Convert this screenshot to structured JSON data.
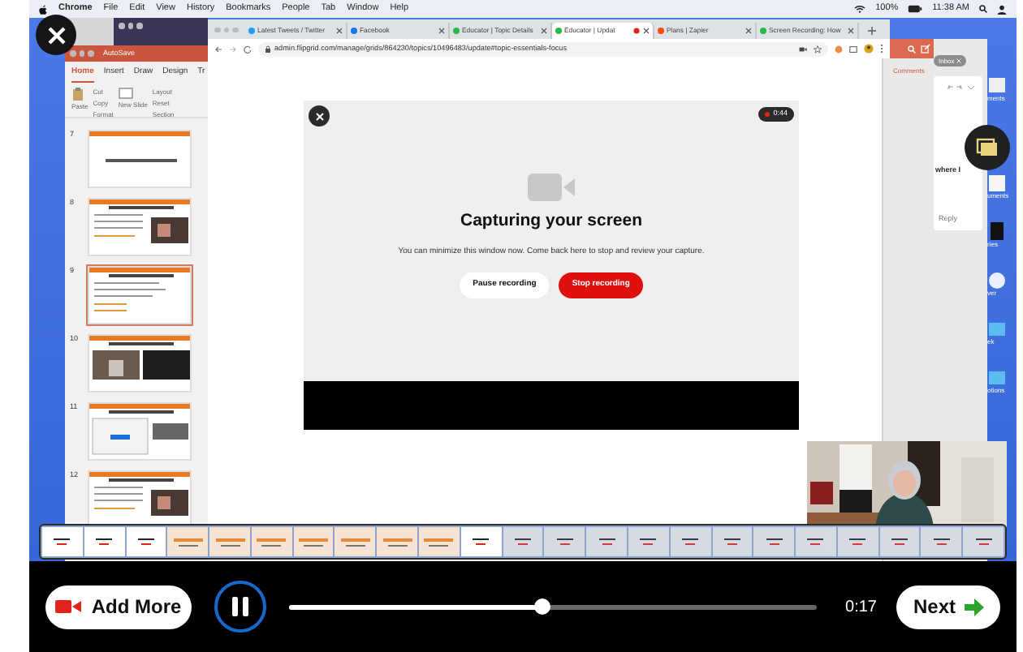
{
  "menu_bar": {
    "app": "Chrome",
    "items": [
      "File",
      "Edit",
      "View",
      "History",
      "Bookmarks",
      "People",
      "Tab",
      "Window",
      "Help"
    ],
    "battery": "100%",
    "time": "11:38 AM"
  },
  "powerpoint": {
    "autosave": "AutoSave",
    "tabs": [
      {
        "label": "Home",
        "selected": true
      },
      {
        "label": "Insert",
        "selected": false
      },
      {
        "label": "Draw",
        "selected": false
      },
      {
        "label": "Design",
        "selected": false
      },
      {
        "label": "Tr",
        "selected": false
      }
    ],
    "ribbon": {
      "paste": "Paste",
      "cut": "Cut",
      "copy": "Copy",
      "format": "Format",
      "new_slide": "New Slide",
      "layout": "Layout",
      "reset": "Reset",
      "section": "Section"
    },
    "slides": [
      {
        "number": "7",
        "kind": "title",
        "selected": false
      },
      {
        "number": "8",
        "kind": "text_photo",
        "selected": false
      },
      {
        "number": "9",
        "kind": "text",
        "selected": true
      },
      {
        "number": "10",
        "kind": "two_photos",
        "selected": false
      },
      {
        "number": "11",
        "kind": "screenshot",
        "selected": false
      },
      {
        "number": "12",
        "kind": "text_photo",
        "selected": false
      }
    ]
  },
  "browser": {
    "tabs": [
      {
        "label": "Latest Tweets / Twitter",
        "kind": "twitter",
        "selected": false,
        "recording": false
      },
      {
        "label": "Facebook",
        "kind": "facebook",
        "selected": false,
        "recording": false
      },
      {
        "label": "Educator | Topic Details",
        "kind": "flipgrid",
        "selected": false,
        "recording": false
      },
      {
        "label": "Educator | Updat",
        "kind": "flipgrid",
        "selected": true,
        "recording": true
      },
      {
        "label": "Plans | Zapier",
        "kind": "zapier",
        "selected": false,
        "recording": false
      },
      {
        "label": "Screen Recording: How",
        "kind": "flipgrid",
        "selected": false,
        "recording": false
      }
    ],
    "url": "admin.flipgrid.com/manage/grids/864230/topics/10496483/update#topic-essentials-focus"
  },
  "capture_dialog": {
    "timer": "0:44",
    "title": "Capturing your screen",
    "message": "You can minimize this window now. Come back here to stop and review your capture.",
    "buttons": [
      {
        "label": "Pause recording",
        "kind": "secondary"
      },
      {
        "label": "Stop recording",
        "kind": "primary"
      }
    ]
  },
  "mail": {
    "comments": "Comments",
    "inbox": "Inbox",
    "snippet": "where I",
    "reply": "Reply"
  },
  "desktop_icons": [
    {
      "label": "ments"
    },
    {
      "label": "uments"
    },
    {
      "label": "ries"
    },
    {
      "label": "ver"
    },
    {
      "label": "ek"
    },
    {
      "label": "otions"
    }
  ],
  "filmstrip": [
    {
      "kind": "dialog",
      "played": true
    },
    {
      "kind": "dialog",
      "played": true
    },
    {
      "kind": "dialog",
      "played": true
    },
    {
      "kind": "slides",
      "played": true
    },
    {
      "kind": "slides",
      "played": true
    },
    {
      "kind": "slides",
      "played": true
    },
    {
      "kind": "slides",
      "played": true
    },
    {
      "kind": "slides",
      "played": true
    },
    {
      "kind": "slides",
      "played": true
    },
    {
      "kind": "slides",
      "played": true
    },
    {
      "kind": "dialog",
      "played": true
    },
    {
      "kind": "dialog",
      "played": false
    },
    {
      "kind": "dialog",
      "played": false
    },
    {
      "kind": "dialog",
      "played": false
    },
    {
      "kind": "dialog",
      "played": false
    },
    {
      "kind": "dialog",
      "played": false
    },
    {
      "kind": "dialog",
      "played": false
    },
    {
      "kind": "dialog",
      "played": false
    },
    {
      "kind": "dialog",
      "played": false
    },
    {
      "kind": "dialog",
      "played": false
    },
    {
      "kind": "dialog",
      "played": false
    },
    {
      "kind": "dialog",
      "played": false
    },
    {
      "kind": "dialog",
      "played": false
    }
  ],
  "controls": {
    "add_more": "Add More",
    "playing": true,
    "level": 0.48,
    "time": "0:17",
    "next": "Next"
  }
}
